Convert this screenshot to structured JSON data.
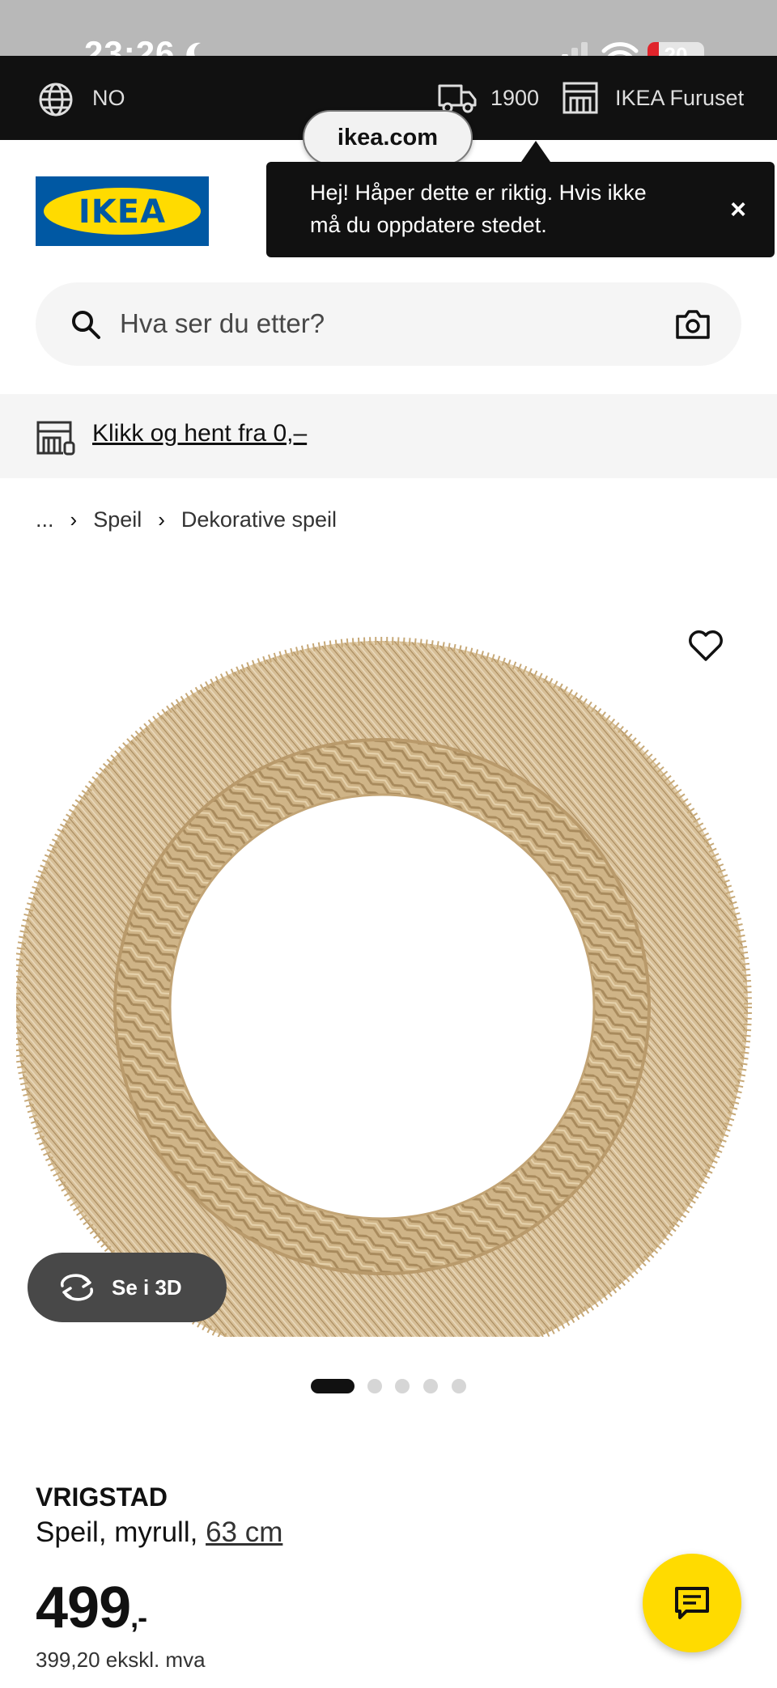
{
  "status_bar": {
    "time": "23:26",
    "battery": "20",
    "icons": [
      "moon-icon",
      "signal-icon",
      "wifi-icon",
      "battery-icon"
    ]
  },
  "top_bar": {
    "language": "NO",
    "postal_code": "1900",
    "store": "IKEA Furuset",
    "icons": [
      "globe-icon",
      "truck-icon",
      "store-icon"
    ]
  },
  "browser": {
    "url": "ikea.com"
  },
  "header": {
    "logo_text": "IKEA"
  },
  "tooltip": {
    "text": "Hej! Håper dette er riktig. Hvis ikke må du oppdatere stedet.",
    "close": "×"
  },
  "search": {
    "placeholder": "Hva ser du etter?"
  },
  "banner": {
    "link": "Klikk og hent fra 0,–"
  },
  "breadcrumb": {
    "items": [
      "...",
      "Speil",
      "Dekorative speil"
    ],
    "separator": "›"
  },
  "gallery": {
    "view_3d_label": "Se i 3D",
    "total_images": 5,
    "active_index": 0
  },
  "product": {
    "name": "VRIGSTAD",
    "description": "Speil, myrull,",
    "size": "63 cm",
    "price": "499",
    "price_suffix": ",-",
    "price_ex_vat": "399,20 ekskl. mva"
  },
  "colors": {
    "ikea_blue": "#0058a3",
    "ikea_yellow": "#ffdb00",
    "dark": "#111111"
  }
}
